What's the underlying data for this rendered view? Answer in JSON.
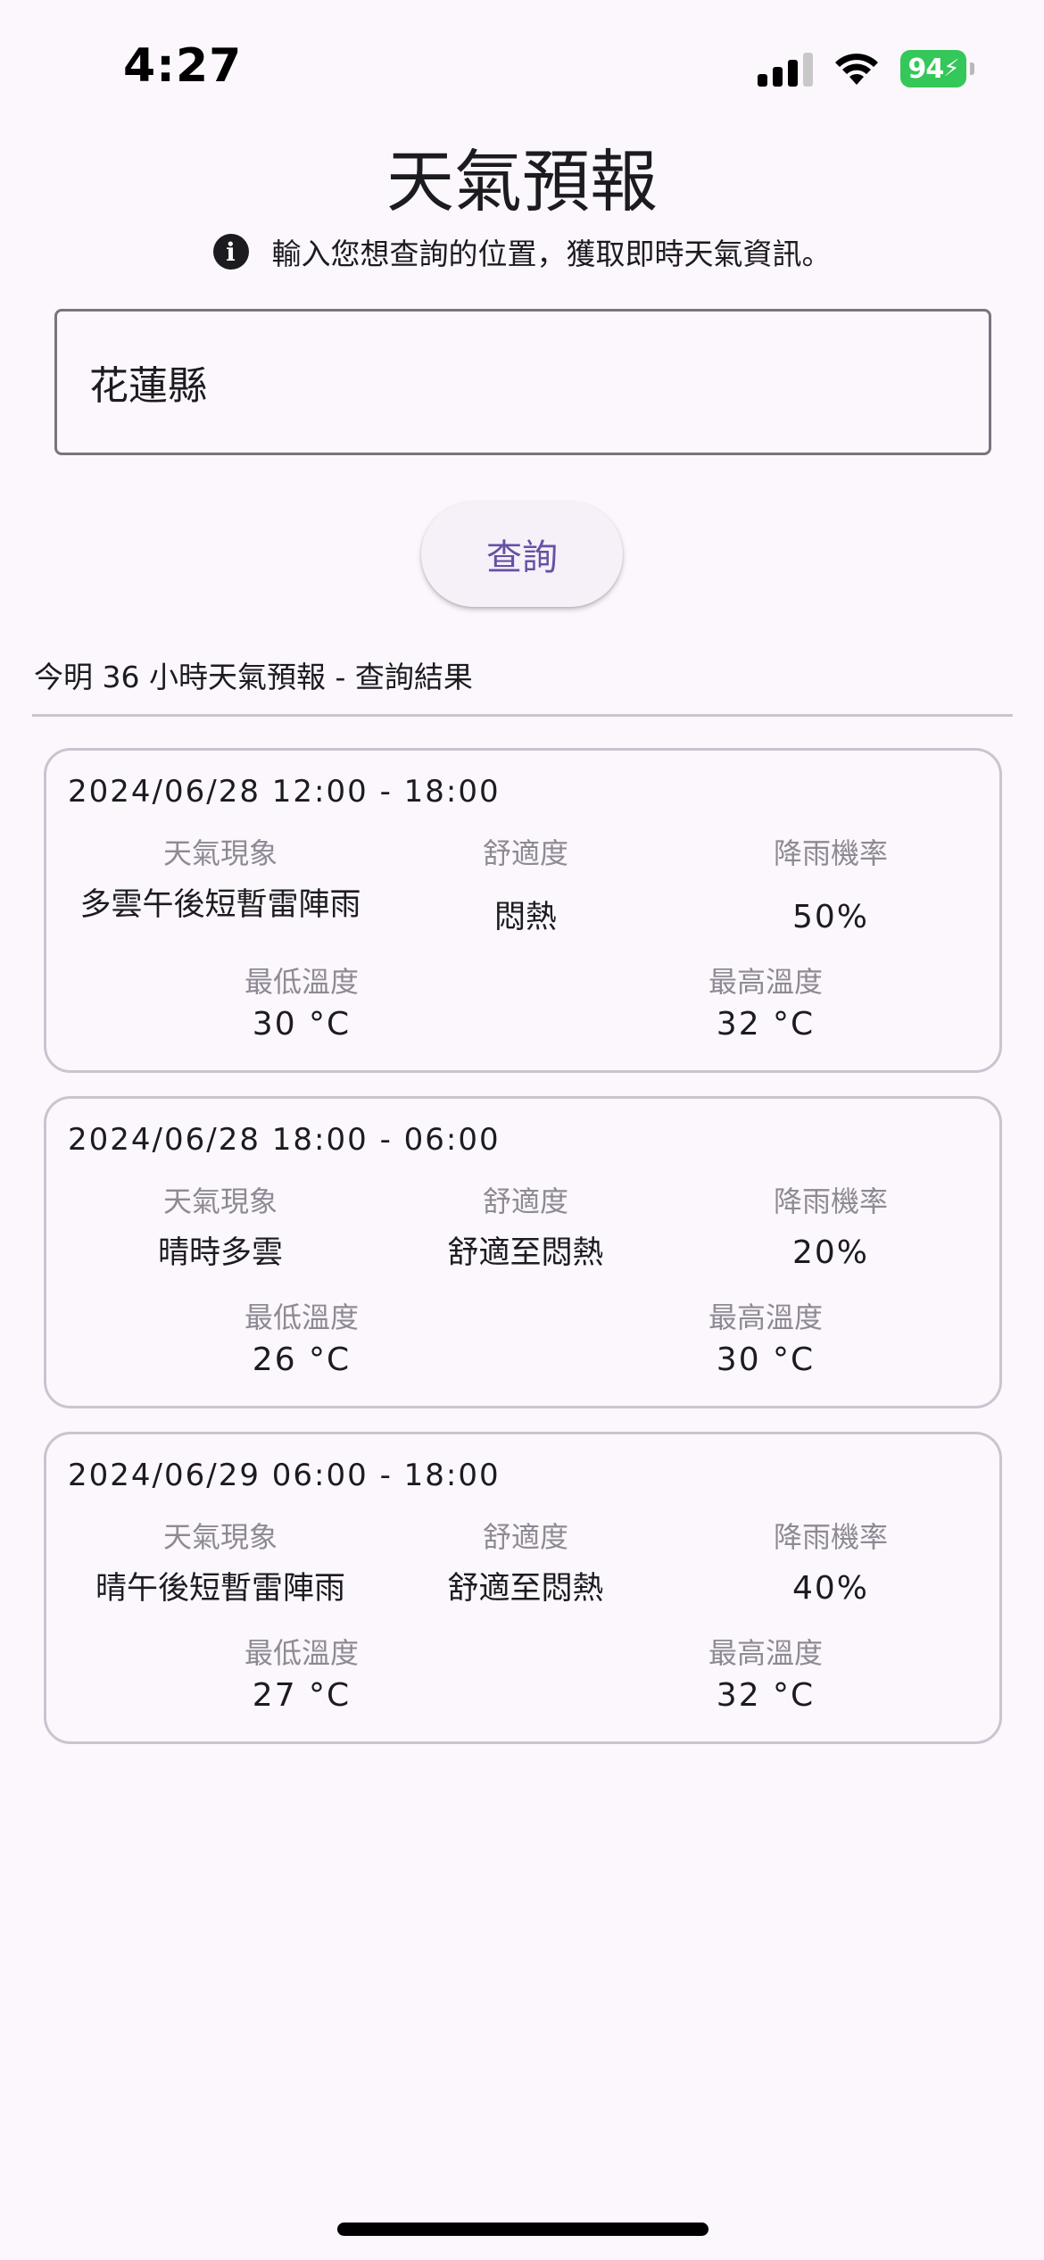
{
  "status_bar": {
    "time": "4:27",
    "battery": "94",
    "icons": [
      "cellular-signal-icon",
      "wifi-icon",
      "battery-charging-icon"
    ]
  },
  "header": {
    "title": "天氣預報",
    "hint": "輸入您想查詢的位置，獲取即時天氣資訊。",
    "hint_icon": "info-icon"
  },
  "search": {
    "value": "花蓮縣",
    "button_label": "查詢"
  },
  "results": {
    "heading": "今明 36 小時天氣預報 - 查詢結果",
    "labels": {
      "weather": "天氣現象",
      "comfort": "舒適度",
      "rain": "降雨機率",
      "min_temp": "最低溫度",
      "max_temp": "最高溫度"
    },
    "cards": [
      {
        "period": "2024/06/28 12:00 - 18:00",
        "weather": "多雲午後短暫雷陣雨",
        "comfort": "悶熱",
        "rain": "50%",
        "min_temp": "30 °C",
        "max_temp": "32 °C"
      },
      {
        "period": "2024/06/28 18:00 - 06:00",
        "weather": "晴時多雲",
        "comfort": "舒適至悶熱",
        "rain": "20%",
        "min_temp": "26 °C",
        "max_temp": "30 °C"
      },
      {
        "period": "2024/06/29 06:00 - 18:00",
        "weather": "晴午後短暫雷陣雨",
        "comfort": "舒適至悶熱",
        "rain": "40%",
        "min_temp": "27 °C",
        "max_temp": "32 °C"
      }
    ]
  },
  "colors": {
    "background": "#FCF7FD",
    "accent": "#6750A4",
    "outline": "#79747E",
    "card_border": "#CAC4D0",
    "battery": "#34C759"
  }
}
